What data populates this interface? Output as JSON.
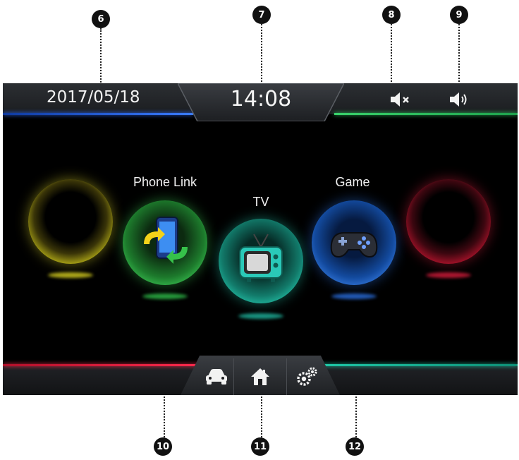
{
  "status_bar": {
    "date": "2017/05/18",
    "time": "14:08",
    "mute_icon": "speaker-mute-icon",
    "volume_icon": "speaker-volume-icon"
  },
  "apps": [
    {
      "id": "yellow",
      "label": "",
      "color": "#e6e02a"
    },
    {
      "id": "phone-link",
      "label": "Phone Link",
      "color": "#37c24d"
    },
    {
      "id": "tv",
      "label": "TV",
      "color": "#1fb8a0"
    },
    {
      "id": "game",
      "label": "Game",
      "color": "#2a6fe0"
    },
    {
      "id": "red",
      "label": "",
      "color": "#e0203f"
    }
  ],
  "dock": {
    "items": [
      {
        "icon": "car-icon"
      },
      {
        "icon": "home-icon"
      },
      {
        "icon": "settings-gears-icon"
      }
    ]
  },
  "callouts": [
    "6",
    "7",
    "8",
    "9",
    "10",
    "11",
    "12"
  ],
  "colors": {
    "accent_blue": "#3a7bff",
    "accent_green": "#2ecf62",
    "accent_red": "#ff2a4d",
    "accent_teal": "#1fc9a8",
    "screen_bg": "#000000"
  }
}
